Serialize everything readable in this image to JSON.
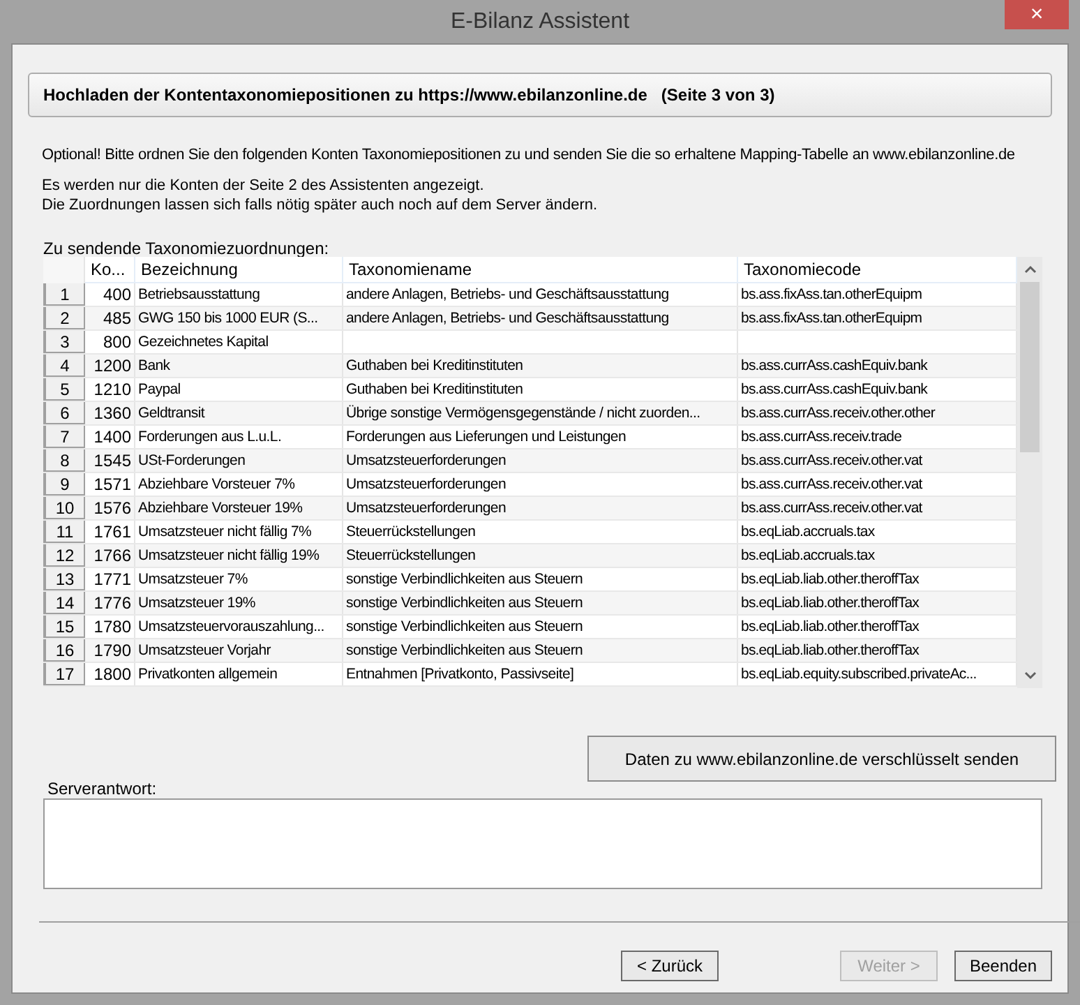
{
  "window": {
    "title": "E-Bilanz Assistent",
    "close": "×"
  },
  "header": "Hochladen der Kontentaxonomiepositionen zu https://www.ebilanzonline.de   (Seite 3 von 3)",
  "intro": "Optional! Bitte ordnen Sie den folgenden Konten Taxonomiepositionen zu und senden Sie die so erhaltene Mapping-Tabelle an www.ebilanzonline.de",
  "notes": [
    "Es werden nur die Konten der Seite 2 des Assistenten angezeigt.",
    "Die Zuordnungen lassen sich falls nötig später auch noch auf dem Server ändern."
  ],
  "table": {
    "label": "Zu sendende Taxonomiezuordnungen:",
    "columns": [
      "Ko...",
      "Bezeichnung",
      "Taxonomiename",
      "Taxonomiecode"
    ],
    "rows": [
      {
        "index": "1",
        "konto": "400",
        "bezeichnung": "Betriebsausstattung",
        "name": "andere Anlagen, Betriebs- und Geschäftsausstattung",
        "code": "bs.ass.fixAss.tan.otherEquipm"
      },
      {
        "index": "2",
        "konto": "485",
        "bezeichnung": "GWG 150 bis 1000 EUR (S...",
        "name": "andere Anlagen, Betriebs- und Geschäftsausstattung",
        "code": "bs.ass.fixAss.tan.otherEquipm"
      },
      {
        "index": "3",
        "konto": "800",
        "bezeichnung": "Gezeichnetes Kapital",
        "name": "",
        "code": ""
      },
      {
        "index": "4",
        "konto": "1200",
        "bezeichnung": "Bank",
        "name": "Guthaben bei Kreditinstituten",
        "code": "bs.ass.currAss.cashEquiv.bank"
      },
      {
        "index": "5",
        "konto": "1210",
        "bezeichnung": "Paypal",
        "name": "Guthaben bei Kreditinstituten",
        "code": "bs.ass.currAss.cashEquiv.bank"
      },
      {
        "index": "6",
        "konto": "1360",
        "bezeichnung": "Geldtransit",
        "name": "Übrige sonstige Vermögensgegenstände / nicht zuorden...",
        "code": "bs.ass.currAss.receiv.other.other"
      },
      {
        "index": "7",
        "konto": "1400",
        "bezeichnung": "Forderungen aus L.u.L.",
        "name": "Forderungen aus Lieferungen und Leistungen",
        "code": "bs.ass.currAss.receiv.trade"
      },
      {
        "index": "8",
        "konto": "1545",
        "bezeichnung": "USt-Forderungen",
        "name": "Umsatzsteuerforderungen",
        "code": "bs.ass.currAss.receiv.other.vat"
      },
      {
        "index": "9",
        "konto": "1571",
        "bezeichnung": "Abziehbare Vorsteuer 7%",
        "name": "Umsatzsteuerforderungen",
        "code": "bs.ass.currAss.receiv.other.vat"
      },
      {
        "index": "10",
        "konto": "1576",
        "bezeichnung": "Abziehbare Vorsteuer 19%",
        "name": "Umsatzsteuerforderungen",
        "code": "bs.ass.currAss.receiv.other.vat"
      },
      {
        "index": "11",
        "konto": "1761",
        "bezeichnung": "Umsatzsteuer nicht fällig 7%",
        "name": "Steuerrückstellungen",
        "code": "bs.eqLiab.accruals.tax"
      },
      {
        "index": "12",
        "konto": "1766",
        "bezeichnung": "Umsatzsteuer nicht fällig 19%",
        "name": "Steuerrückstellungen",
        "code": "bs.eqLiab.accruals.tax"
      },
      {
        "index": "13",
        "konto": "1771",
        "bezeichnung": "Umsatzsteuer 7%",
        "name": "sonstige Verbindlichkeiten aus Steuern",
        "code": "bs.eqLiab.liab.other.theroffTax"
      },
      {
        "index": "14",
        "konto": "1776",
        "bezeichnung": "Umsatzsteuer 19%",
        "name": "sonstige Verbindlichkeiten aus Steuern",
        "code": "bs.eqLiab.liab.other.theroffTax"
      },
      {
        "index": "15",
        "konto": "1780",
        "bezeichnung": "Umsatzsteuervorauszahlung...",
        "name": "sonstige Verbindlichkeiten aus Steuern",
        "code": "bs.eqLiab.liab.other.theroffTax"
      },
      {
        "index": "16",
        "konto": "1790",
        "bezeichnung": "Umsatzsteuer Vorjahr",
        "name": "sonstige Verbindlichkeiten aus Steuern",
        "code": "bs.eqLiab.liab.other.theroffTax"
      },
      {
        "index": "17",
        "konto": "1800",
        "bezeichnung": "Privatkonten allgemein",
        "name": "Entnahmen [Privatkonto, Passivseite]",
        "code": "bs.eqLiab.equity.subscribed.privateAc..."
      }
    ]
  },
  "send_button": "Daten zu www.ebilanzonline.de verschlüsselt senden",
  "server_response": {
    "label": "Serverantwort:"
  },
  "buttons": [
    {
      "label": "< Zurück",
      "disabled": false
    },
    {
      "label": "Weiter >",
      "disabled": true
    },
    {
      "label": "Beenden",
      "disabled": false
    }
  ]
}
